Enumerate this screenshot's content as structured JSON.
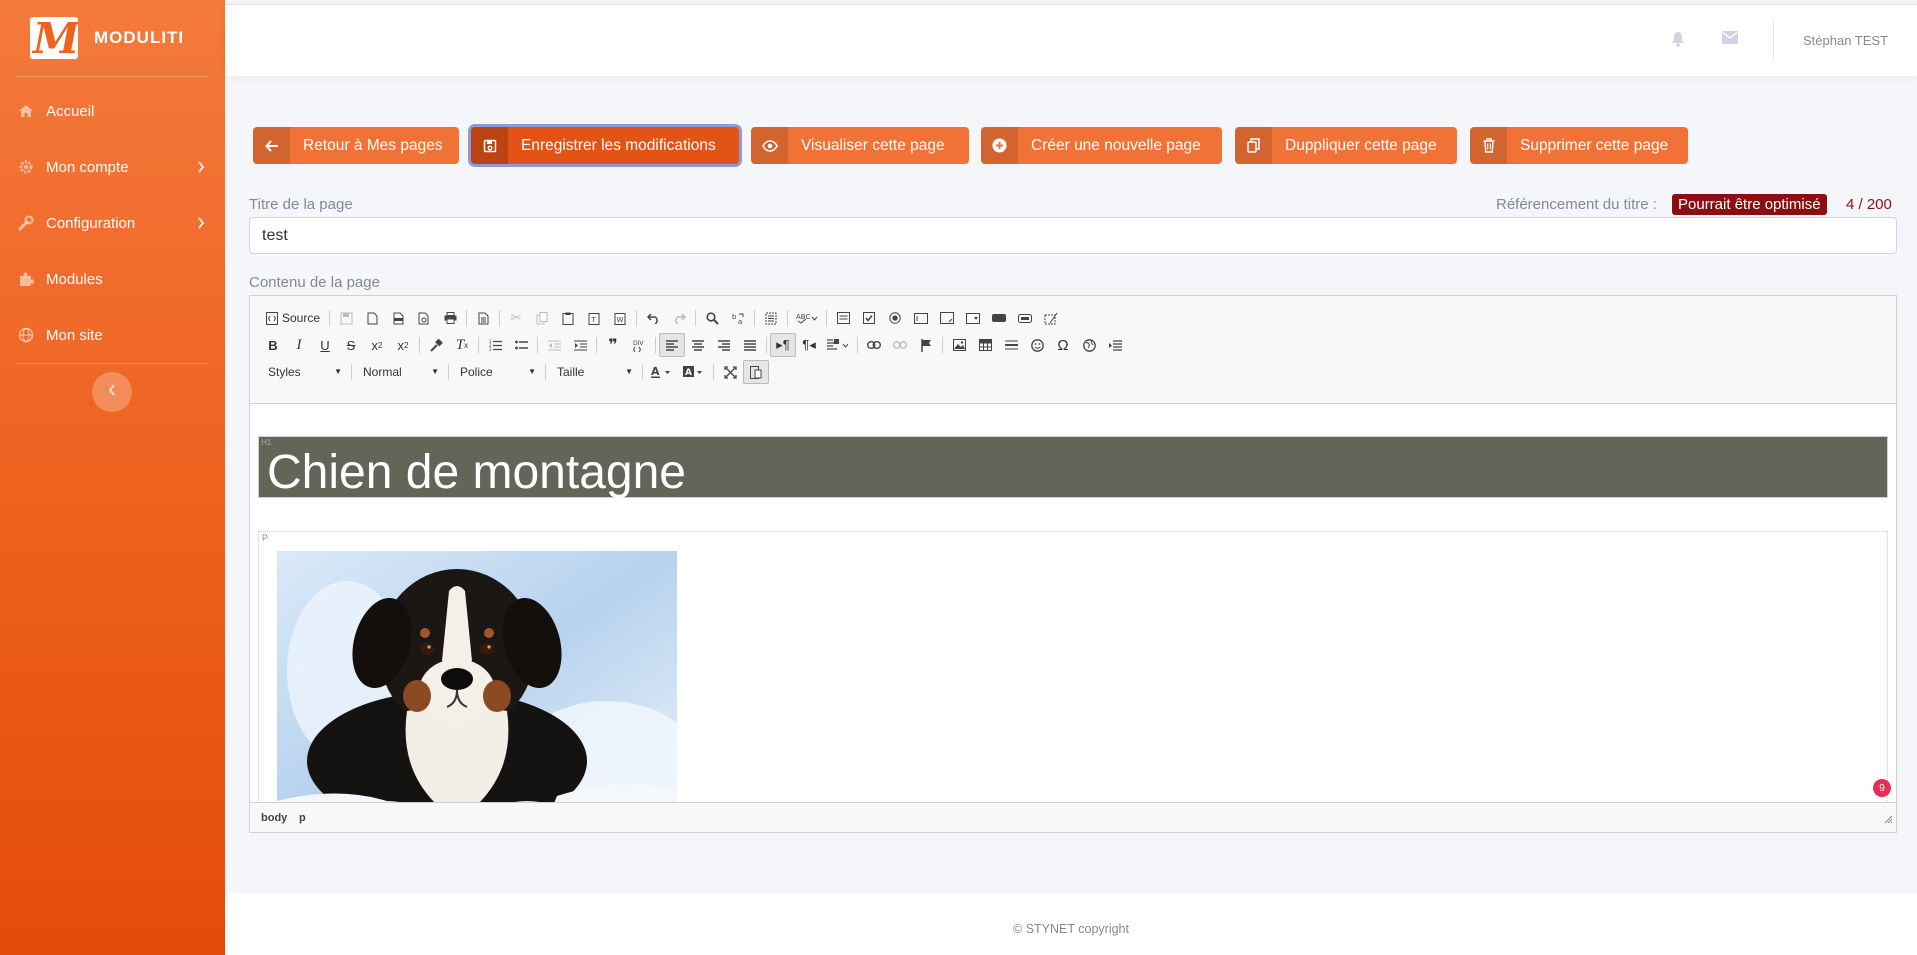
{
  "brand": {
    "name": "MODULITI",
    "logo_letter": "M"
  },
  "sidebar": {
    "items": [
      {
        "label": "Accueil",
        "icon": "home-icon"
      },
      {
        "label": "Mon compte",
        "icon": "gear-icon",
        "has_submenu": true
      },
      {
        "label": "Configuration",
        "icon": "wrench-icon",
        "has_submenu": true
      },
      {
        "label": "Modules",
        "icon": "puzzle-icon"
      },
      {
        "label": "Mon site",
        "icon": "globe-icon"
      }
    ],
    "collapse_icon": "chevron-left-icon"
  },
  "topbar": {
    "user_name": "Stéphan TEST",
    "icons": [
      "bell-icon",
      "envelope-icon"
    ]
  },
  "actions": [
    {
      "label": "Retour à Mes pages",
      "icon": "arrow-left-icon"
    },
    {
      "label": "Enregistrer les modifications",
      "icon": "floppy-icon"
    },
    {
      "label": "Visualiser cette page",
      "icon": "eye-icon"
    },
    {
      "label": "Créer une nouvelle page",
      "icon": "plus-circle-icon"
    },
    {
      "label": "Duppliquer cette page",
      "icon": "copy-icon"
    },
    {
      "label": "Supprimer cette page",
      "icon": "trash-icon"
    }
  ],
  "form": {
    "title_label": "Titre de la page",
    "title_value": "test",
    "seo_label": "Référencement du titre :",
    "seo_status": "Pourrait être optimisé",
    "seo_count": "4 / 200",
    "seo_color": "#8b0f10",
    "content_label": "Contenu de la page"
  },
  "editor": {
    "source_label": "Source",
    "combos": {
      "styles": "Styles",
      "format": "Normal",
      "font": "Police",
      "size": "Taille"
    },
    "heading_tag": "H1",
    "heading_text": "Chien de montagne",
    "paragraph_tag": "P",
    "notification_count": "9",
    "path": [
      "body",
      "p"
    ]
  },
  "footer": {
    "copyright": "© STYNET copyright"
  },
  "colors": {
    "accent": "#f07236",
    "accent_dark": "#e45316",
    "heading_bg": "#626659"
  }
}
